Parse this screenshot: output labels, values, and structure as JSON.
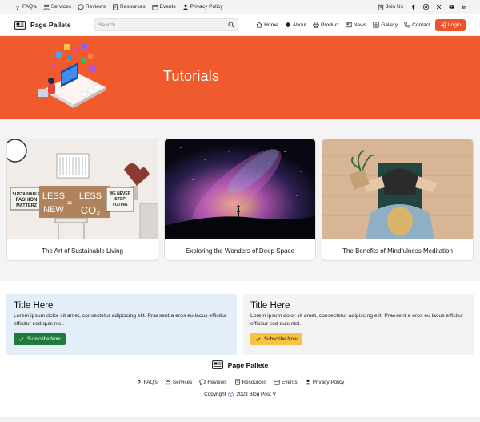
{
  "topbar": {
    "links": [
      {
        "label": "FAQ's",
        "icon": "question-icon"
      },
      {
        "label": "Services",
        "icon": "users-icon"
      },
      {
        "label": "Reviews",
        "icon": "chat-bubble-icon"
      },
      {
        "label": "Resources",
        "icon": "book-icon"
      },
      {
        "label": "Events",
        "icon": "calendar-icon"
      },
      {
        "label": "Privacy Policy",
        "icon": "shield-user-icon"
      }
    ],
    "join_label": "Join Us",
    "socials": [
      "facebook-icon",
      "instagram-icon",
      "x-icon",
      "youtube-icon",
      "linkedin-icon"
    ]
  },
  "navbar": {
    "brand": "Page Pallete",
    "search_placeholder": "Search...",
    "links": [
      {
        "label": "Home",
        "icon": "home-icon"
      },
      {
        "label": "About",
        "icon": "diamond-icon"
      },
      {
        "label": "Product",
        "icon": "printer-icon"
      },
      {
        "label": "News",
        "icon": "newspaper-icon"
      },
      {
        "label": "Gallery",
        "icon": "grid-icon"
      },
      {
        "label": "Contact",
        "icon": "phone-icon"
      }
    ],
    "login_label": "Login"
  },
  "hero": {
    "title": "Tutorials",
    "accent": "#f05a2c"
  },
  "cards": [
    {
      "title": "The Art of Sustainable Living"
    },
    {
      "title": "Exploring the Wonders of Deep Space"
    },
    {
      "title": "The Benefits of Mindfulness Meditation"
    }
  ],
  "card_signs": {
    "less_new": "LESS NEW",
    "less_co2": "LESS CO₂",
    "sustainable": "SUSTAINABLE FASHION MATTERZ",
    "voting": "WE NEVER STOP VOTING"
  },
  "blocks": [
    {
      "title": "Title Here",
      "text": "Lorem ipsum dolor sit amet, consectetur adipiscing elit. Praesent a eros eu lacus efficitur efficitur sed quis nisl.",
      "button": "Subscribe Now",
      "color": "#1f7a3c"
    },
    {
      "title": "Title Here",
      "text": "Lorem ipsum dolor sit amet, consectetur adipiscing elit. Praesent a eros eu lacus efficitur efficitur sed quis nisl.",
      "button": "Subscribe Now",
      "color": "#f6c344"
    }
  ],
  "footer": {
    "brand": "Page Pallete",
    "copyright_prefix": "Copyright",
    "copyright_suffix": "2023 Blog Post V"
  }
}
